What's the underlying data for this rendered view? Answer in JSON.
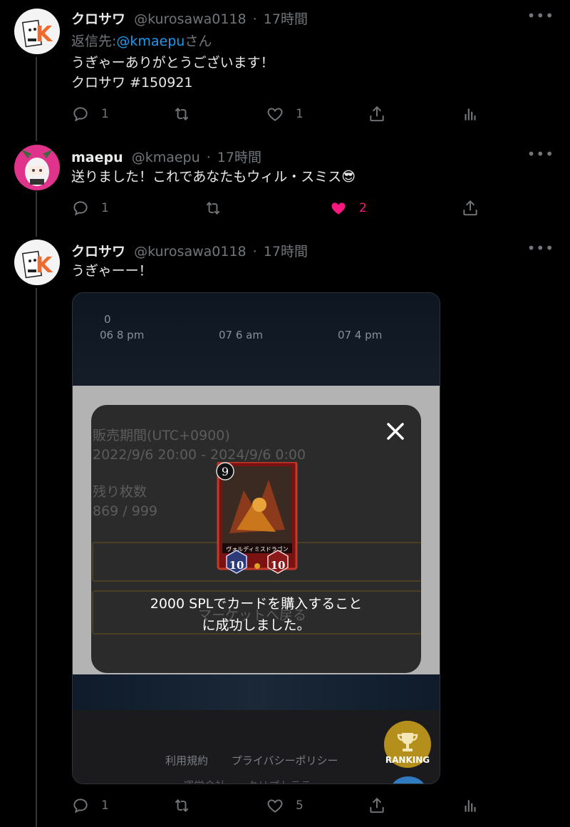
{
  "tweets": [
    {
      "name": "クロサワ",
      "handle": "@kurosawa0118",
      "time": "17時間",
      "reply_prefix": "返信先:",
      "reply_mention": "@kmaepu",
      "reply_suffix": "さん",
      "text_lines": [
        "うぎゃーありがとうございます！",
        "クロサワ #150921"
      ],
      "replies": "1",
      "likes": "1"
    },
    {
      "name": "maepu",
      "handle": "@kmaepu",
      "time": "17時間",
      "text": "送りました！これであなたもウィル・スミス😎",
      "replies": "1",
      "likes": "2"
    },
    {
      "name": "クロサワ",
      "handle": "@kurosawa0118",
      "time": "17時間",
      "text": "うぎゃーー！",
      "replies": "1",
      "likes": "5"
    }
  ],
  "separator": "·",
  "more_label": "•••",
  "media": {
    "chart_zero": "0",
    "chart_ticks": [
      "06 8 pm",
      "07 6 am",
      "07 4 pm"
    ],
    "ghost_lines": [
      "販売期間(UTC+0900)",
      "2022/9/6 20:00 - 2024/9/6 0:00",
      "残り枚数",
      "869 / 999"
    ],
    "ghost_button": "マーケットへ戻る",
    "modal": {
      "card_cost": "9",
      "card_name": "ヴォルディミスドラゴン",
      "card_attack": "10",
      "card_life": "10",
      "message_lines": [
        "2000 SPLでカードを購入すること",
        "に成功しました。"
      ]
    },
    "footer_links": [
      "利用規約",
      "プライバシーポリシー"
    ],
    "footer_links2": "運営会社　　クリプトラテ",
    "ranking_label": "RANKING"
  },
  "colors": {
    "link": "#1d9bf0",
    "like": "#f91880",
    "muted": "#71767b"
  }
}
